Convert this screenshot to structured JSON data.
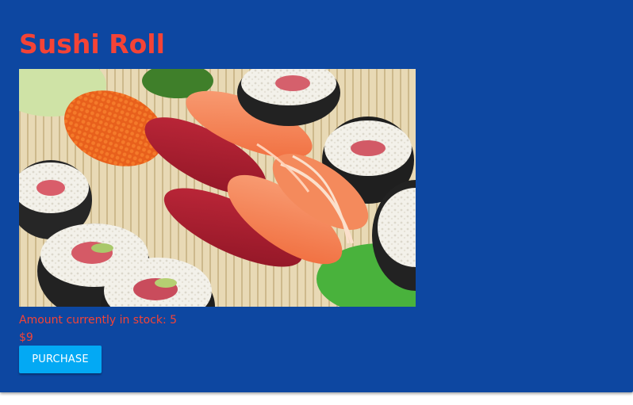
{
  "product": {
    "title": "Sushi Roll",
    "image_alt": "Sushi Roll",
    "stock_text": "Amount currently in stock: 5",
    "price": "$9",
    "purchase_label": "PURCHASE"
  },
  "colors": {
    "card_background": "#0d47a1",
    "text_accent": "#f44336",
    "button_background": "#03a9f4",
    "button_text": "#ffffff",
    "page_background": "#ffffff"
  }
}
